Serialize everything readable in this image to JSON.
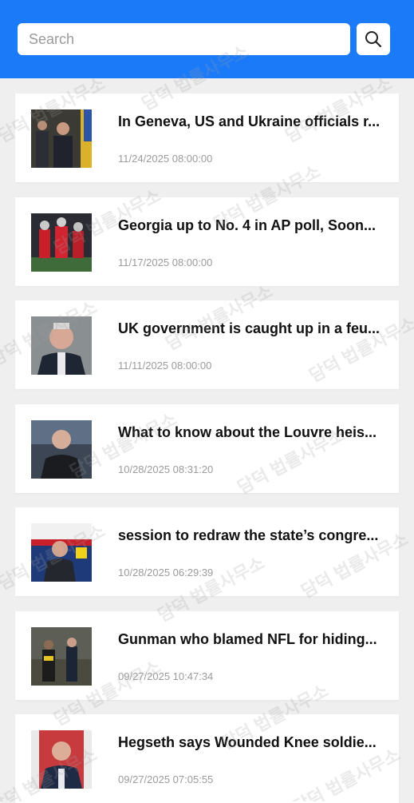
{
  "search": {
    "placeholder": "Search"
  },
  "icons": {
    "search_button": "search-icon"
  },
  "colors": {
    "header": "#1a7af8"
  },
  "watermark_text": "담덕 법률사무소",
  "articles": [
    {
      "title": "In Geneva, US and Ukraine officials r...",
      "date": "11/24/2025 08:00:00"
    },
    {
      "title": "Georgia up to No. 4 in AP poll, Soon...",
      "date": "11/17/2025 08:00:00"
    },
    {
      "title": "UK government is caught up in a feu...",
      "date": "11/11/2025 08:00:00"
    },
    {
      "title": "What to know about the Louvre heis...",
      "date": "10/28/2025 08:31:20"
    },
    {
      "title": "session to redraw the state’s congre...",
      "date": "10/28/2025 06:29:39"
    },
    {
      "title": "Gunman who blamed NFL for hiding...",
      "date": "09/27/2025 10:47:34"
    },
    {
      "title": "Hegseth says Wounded Knee soldie...",
      "date": "09/27/2025 07:05:55"
    }
  ]
}
